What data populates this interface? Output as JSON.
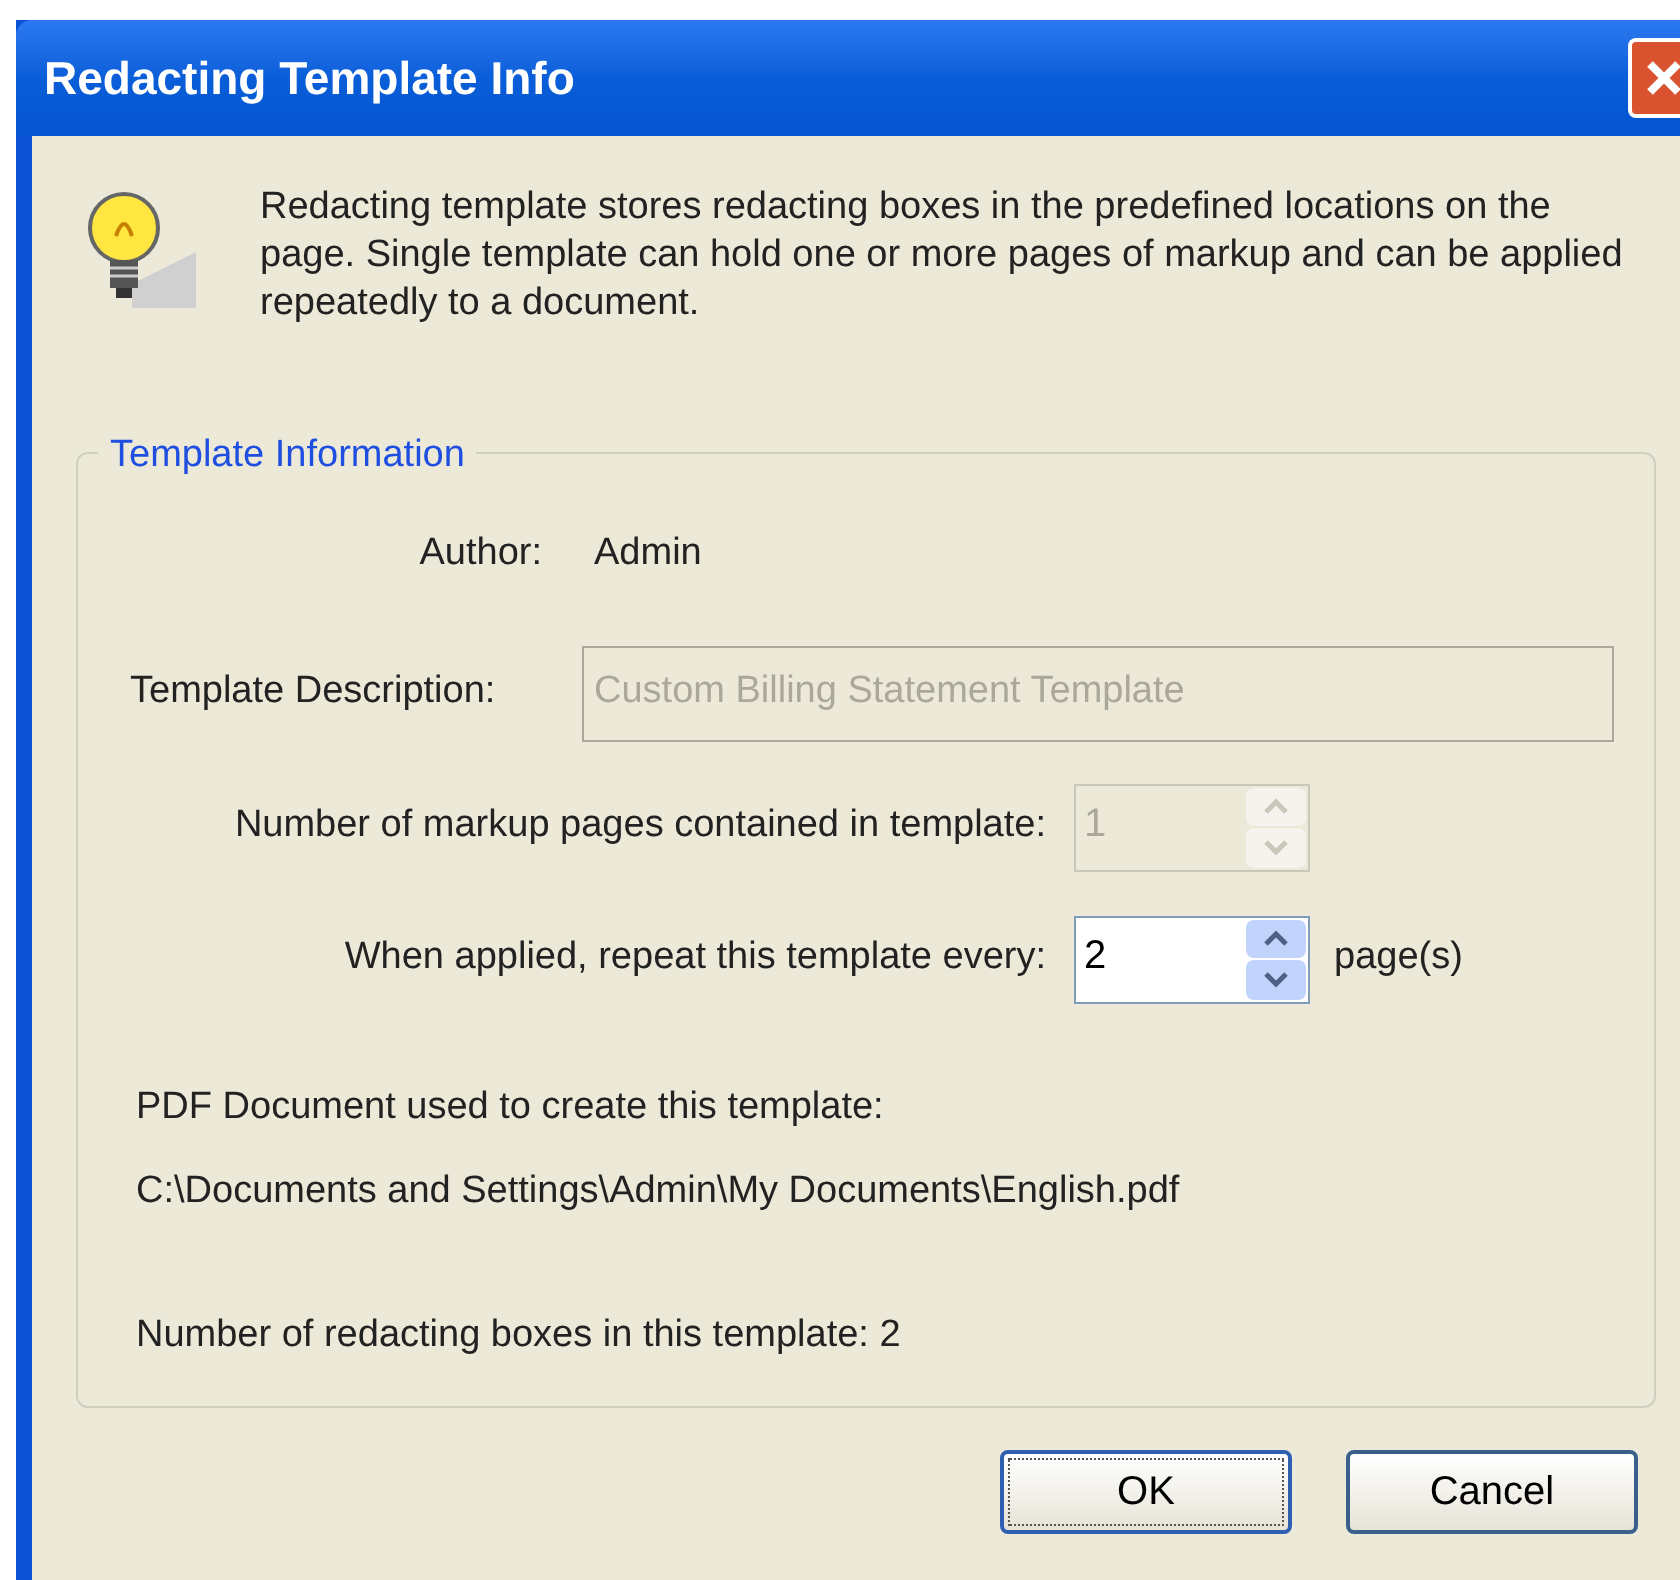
{
  "window": {
    "title": "Redacting Template Info"
  },
  "message": "Redacting template stores redacting boxes in the predefined locations on the page. Single template can hold one or more pages of markup and can be applied repeatedly to a document.",
  "group": {
    "title": "Template Information",
    "author": {
      "label": "Author:",
      "value": "Admin"
    },
    "description": {
      "label": "Template Description:",
      "value": "Custom Billing Statement Template",
      "disabled": true
    },
    "markup_pages": {
      "label": "Number of markup pages contained in template:",
      "value": "1",
      "disabled": true
    },
    "repeat": {
      "label": "When applied, repeat this template every:",
      "value": "2",
      "disabled": false,
      "unit": "page(s)"
    },
    "pdf_label": "PDF Document used to create this template:",
    "pdf_path": "C:\\Documents and Settings\\Admin\\My Documents\\English.pdf",
    "boxes": "Number of redacting boxes in this template: 2"
  },
  "buttons": [
    {
      "label": "OK",
      "default": true
    },
    {
      "label": "Cancel",
      "default": false
    }
  ]
}
